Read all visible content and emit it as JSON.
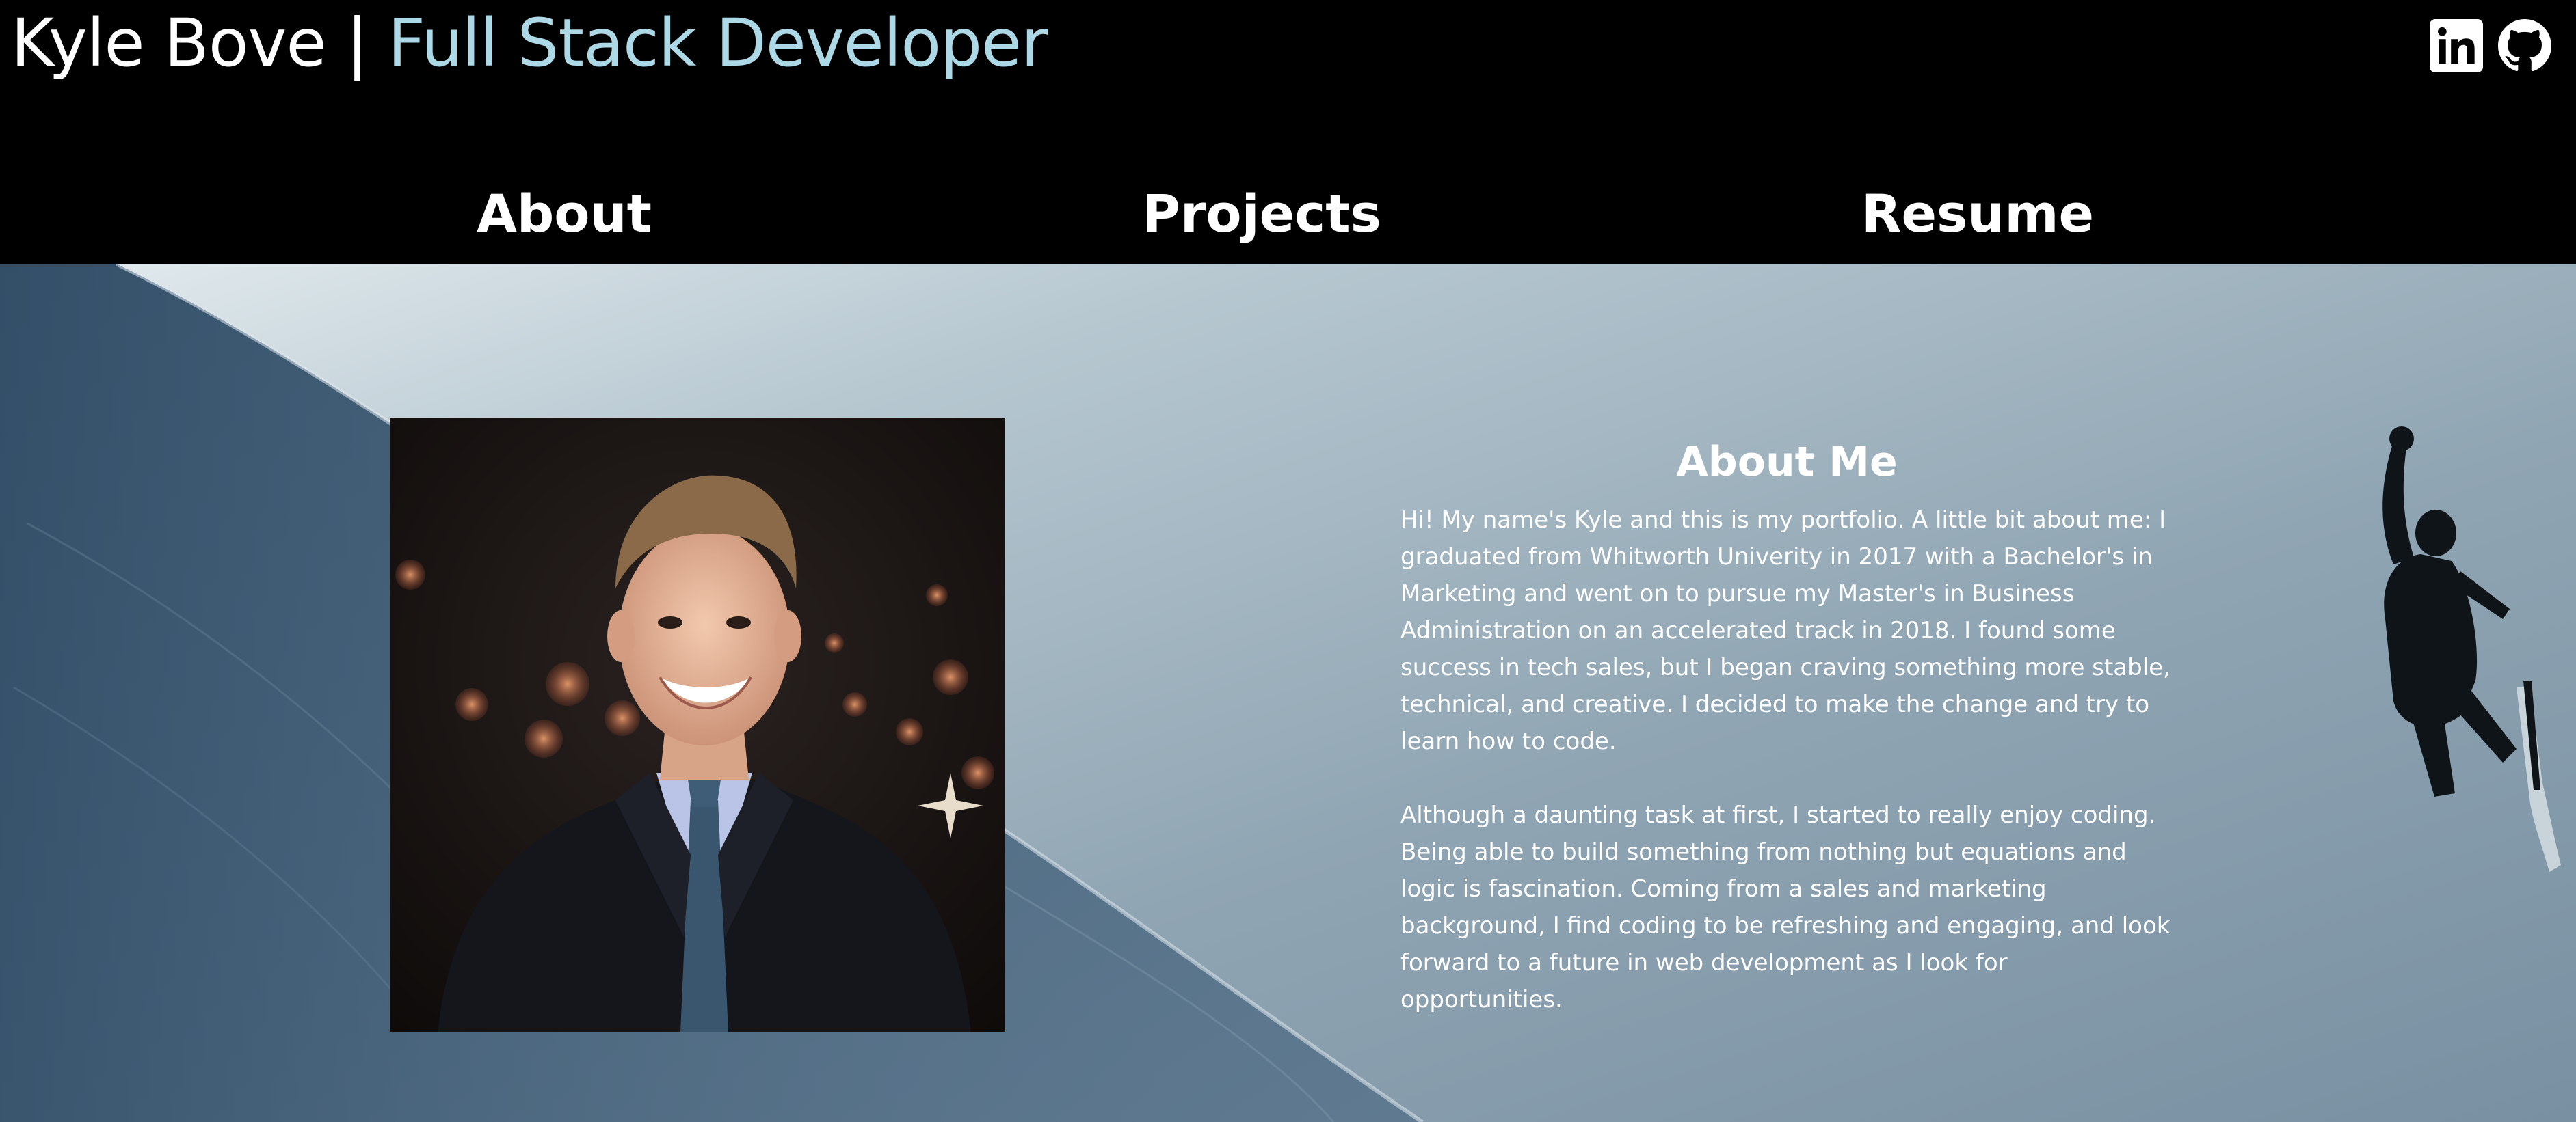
{
  "header": {
    "name": "Kyle Bove",
    "separator": " | ",
    "role": "Full Stack Developer",
    "social": [
      {
        "icon": "linkedin-icon"
      },
      {
        "icon": "github-icon"
      }
    ]
  },
  "nav": {
    "items": [
      {
        "label": "About"
      },
      {
        "label": "Projects"
      },
      {
        "label": "Resume"
      }
    ]
  },
  "about": {
    "title": "About Me",
    "paragraphs": [
      "Hi! My name's Kyle and this is my portfolio. A little bit about me: I graduated from Whitworth Univerity in 2017 with a Bachelor's in Marketing and went on to pursue my Master's in Business Administration on an accelerated track in 2018. I found some success in tech sales, but I began craving something more stable, technical, and creative. I decided to make the change and try to learn how to code.",
      "Although a daunting task at first, I started to really enjoy coding. Being able to build something from nothing but equations and logic is fascination. Coming from a sales and marketing background, I find coding to be refreshing and engaging, and look forward to a future in web development as I look for opportunities."
    ]
  },
  "colors": {
    "header_bg": "#000000",
    "name": "#ffffff",
    "role": "#add8e6",
    "nav_text": "#ffffff",
    "body_text": "#ffffff"
  }
}
